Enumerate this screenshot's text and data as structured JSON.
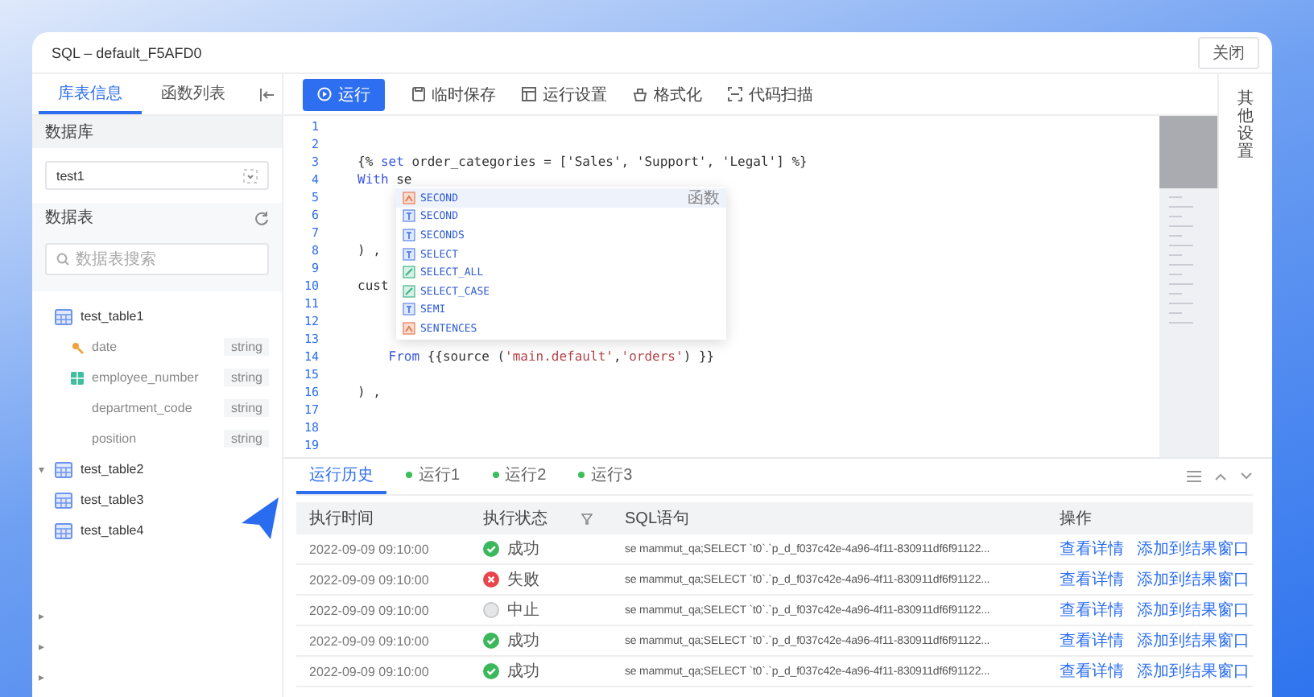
{
  "window": {
    "title": "SQL – default_F5AFD0",
    "close_button": "关闭"
  },
  "sidebar": {
    "tabs": [
      {
        "label": "库表信息",
        "selected": true
      },
      {
        "label": "函数列表",
        "selected": false
      }
    ],
    "database_heading": "数据库",
    "database_select": {
      "value": "test1"
    },
    "tables_heading": "数据表",
    "search": {
      "placeholder": "数据表搜索"
    },
    "tree": [
      {
        "name": "test_table1",
        "children": [
          {
            "name": "date",
            "type": "string",
            "kind": "key"
          },
          {
            "name": "employee_number",
            "type": "string",
            "kind": "column"
          },
          {
            "name": "department_code",
            "type": "string",
            "kind": "plain"
          },
          {
            "name": "position",
            "type": "string",
            "kind": "plain"
          }
        ]
      },
      {
        "name": "test_table2",
        "caret": "▾"
      },
      {
        "name": "test_table3"
      },
      {
        "name": "test_table4"
      },
      {
        "caret": "▸"
      },
      {
        "caret": "▸"
      },
      {
        "caret": "▸"
      }
    ]
  },
  "toolbar": [
    {
      "label": "运行",
      "kind": "primary"
    },
    {
      "label": "临时保存",
      "kind": "save"
    },
    {
      "label": "运行设置",
      "kind": "settings"
    },
    {
      "label": "格式化",
      "kind": "format"
    },
    {
      "label": "代码扫描",
      "kind": "scan"
    }
  ],
  "editor": {
    "lines": [
      {
        "number": "1"
      },
      {
        "number": "2"
      },
      {
        "number": "3",
        "tokens": [
          {
            "text": "{% ",
            "kind": "plain"
          },
          {
            "text": "set",
            "kind": "keyword"
          },
          {
            "text": " order_categories = ['Sales', 'Support', 'Legal'] %}",
            "kind": "plain"
          }
        ]
      },
      {
        "number": "4",
        "tokens": [
          {
            "text": "With",
            "kind": "keyword"
          },
          {
            "text": " se",
            "kind": "plain"
          }
        ]
      },
      {
        "number": "5"
      },
      {
        "number": "6"
      },
      {
        "number": "7"
      },
      {
        "number": "8",
        "tokens": [
          {
            "text": ") ,",
            "kind": "plain"
          }
        ]
      },
      {
        "number": "9"
      },
      {
        "number": "10",
        "tokens": [
          {
            "text": "cust",
            "kind": "plain"
          }
        ]
      },
      {
        "number": "11"
      },
      {
        "number": "12"
      },
      {
        "number": "13"
      },
      {
        "number": "14",
        "tokens": [
          {
            "text": "    From",
            "kind": "keyword"
          },
          {
            "text": " {{source (",
            "kind": "plain"
          },
          {
            "text": "'main.default'",
            "kind": "string"
          },
          {
            "text": ",",
            "kind": "plain"
          },
          {
            "text": "'orders'",
            "kind": "string"
          },
          {
            "text": ") }}",
            "kind": "plain"
          }
        ]
      },
      {
        "number": "15"
      },
      {
        "number": "16",
        "tokens": [
          {
            "text": ") ,",
            "kind": "plain"
          }
        ]
      },
      {
        "number": "17"
      },
      {
        "number": "18"
      },
      {
        "number": "19"
      }
    ],
    "suggestions": [
      {
        "label": "SECOND",
        "kind": "function",
        "hint": "函数",
        "selected": true
      },
      {
        "label": "SECOND",
        "kind": "keyword",
        "selected": false
      },
      {
        "label": "SECONDS",
        "kind": "keyword",
        "selected": false
      },
      {
        "label": "SELECT",
        "kind": "keyword",
        "selected": false
      },
      {
        "label": "SELECT_ALL",
        "kind": "snippet",
        "selected": false
      },
      {
        "label": "SELECT_CASE",
        "kind": "snippet",
        "selected": false
      },
      {
        "label": "SEMI",
        "kind": "keyword",
        "selected": false
      },
      {
        "label": "SENTENCES",
        "kind": "function",
        "selected": false
      }
    ]
  },
  "settings_tab": "其他设置",
  "results": {
    "tabs": [
      {
        "label": "运行历史",
        "selected": true,
        "dot": false
      },
      {
        "label": "运行1",
        "selected": false,
        "dot": true
      },
      {
        "label": "运行2",
        "selected": false,
        "dot": true
      },
      {
        "label": "运行3",
        "selected": false,
        "dot": true
      }
    ],
    "columns": [
      "执行时间",
      "执行状态",
      "SQL语句",
      "操作"
    ],
    "rows": [
      {
        "time": "2022-09-09 09:10:00",
        "status": "成功",
        "kind": "success",
        "sql": "se mammut_qa;SELECT `t0`.`p_d_f037c42e-4a96-4f11-830911df6f91122...",
        "actions": [
          "查看详情",
          "添加到结果窗口"
        ]
      },
      {
        "time": "2022-09-09 09:10:00",
        "status": "失败",
        "kind": "failure",
        "sql": "se mammut_qa;SELECT `t0`.`p_d_f037c42e-4a96-4f11-830911df6f91122...",
        "actions": [
          "查看详情",
          "添加到结果窗口"
        ]
      },
      {
        "time": "2022-09-09 09:10:00",
        "status": "中止",
        "kind": "stopped",
        "sql": "se mammut_qa;SELECT `t0`.`p_d_f037c42e-4a96-4f11-830911df6f91122...",
        "actions": [
          "查看详情",
          "添加到结果窗口"
        ]
      },
      {
        "time": "2022-09-09 09:10:00",
        "status": "成功",
        "kind": "success",
        "sql": "se mammut_qa;SELECT `t0`.`p_d_f037c42e-4a96-4f11-830911df6f91122...",
        "actions": [
          "查看详情",
          "添加到结果窗口"
        ]
      },
      {
        "time": "2022-09-09 09:10:00",
        "status": "成功",
        "kind": "success",
        "sql": "se mammut_qa;SELECT `t0`.`p_d_f037c42e-4a96-4f11-830911df6f91122...",
        "actions": [
          "查看详情",
          "添加到结果窗口"
        ]
      }
    ]
  }
}
